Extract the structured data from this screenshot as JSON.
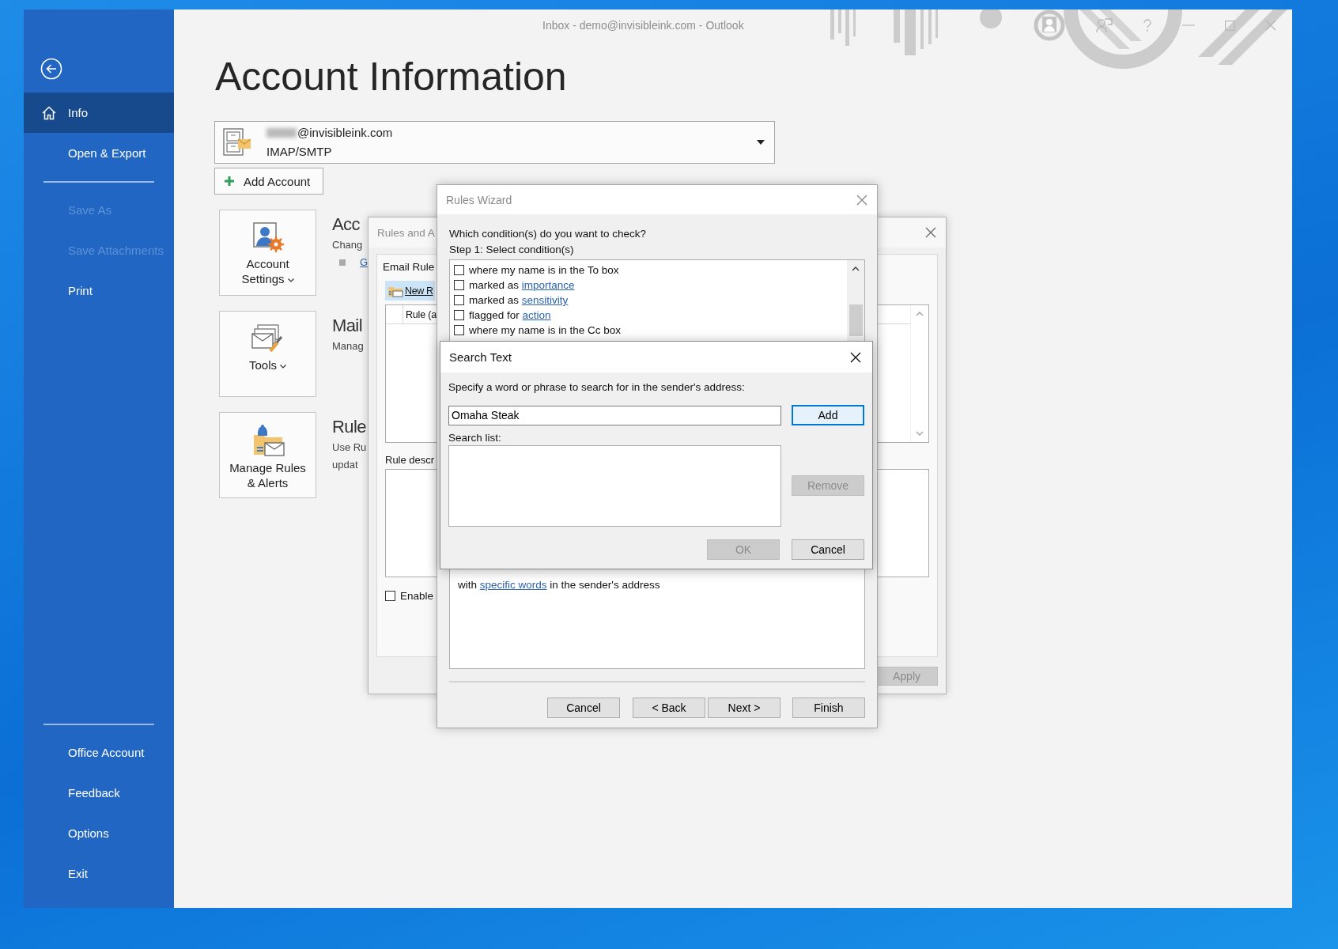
{
  "window": {
    "title": "Inbox - demo@invisibleink.com - Outlook"
  },
  "sidebar": {
    "top_groups": [
      [
        {
          "label": "Info",
          "selected": true,
          "disabled": false
        },
        {
          "label": "Open & Export",
          "selected": false,
          "disabled": false
        }
      ],
      [
        {
          "label": "Save As",
          "selected": false,
          "disabled": true
        },
        {
          "label": "Save Attachments",
          "selected": false,
          "disabled": true
        },
        {
          "label": "Print",
          "selected": false,
          "disabled": false
        }
      ]
    ],
    "bottom_items": [
      {
        "label": "Office Account",
        "selected": false,
        "disabled": false
      },
      {
        "label": "Feedback",
        "selected": false,
        "disabled": false
      },
      {
        "label": "Options",
        "selected": false,
        "disabled": false
      },
      {
        "label": "Exit",
        "selected": false,
        "disabled": false
      }
    ]
  },
  "account_info": {
    "heading": "Account Information",
    "account": {
      "email": "@invisibleink.com",
      "type": "IMAP/SMTP"
    },
    "add_account": "Add Account",
    "sections": [
      {
        "tile": "Account Settings",
        "menu": true,
        "heading": "Acc",
        "lines": [
          "Chang"
        ],
        "link": "G"
      },
      {
        "tile": "Tools",
        "menu": true,
        "heading": "Mail",
        "lines": [
          "Manag"
        ]
      },
      {
        "tile": "Manage Rules & Alerts",
        "menu": false,
        "heading": "Rule",
        "lines": [
          "Use Ru",
          "updat"
        ]
      }
    ]
  },
  "rules_and_alerts": {
    "title": "Rules and A",
    "tab": "Email Rule",
    "new_rule": "New R",
    "column": "Rule (a",
    "description_label": "Rule descr",
    "enable": {
      "label": "Enable",
      "checked": false
    },
    "apply": {
      "label": "Apply",
      "disabled": true
    }
  },
  "rules_wizard": {
    "title": "Rules Wizard",
    "question": "Which condition(s) do you want to check?",
    "step": "Step 1: Select condition(s)",
    "conditions": [
      {
        "text": "where my name is in the To box",
        "checked": false
      },
      {
        "text": "marked as",
        "link": "importance",
        "checked": false
      },
      {
        "text": "marked as",
        "link": "sensitivity",
        "checked": false
      },
      {
        "text": "flagged for",
        "link": "action",
        "checked": false
      },
      {
        "text": "where my name is in the Cc box",
        "checked": false
      }
    ],
    "description": {
      "text": "with",
      "link": "specific words",
      "after": "in the sender's address"
    },
    "buttons": [
      {
        "label": "Cancel",
        "disabled": false
      },
      {
        "label": "< Back",
        "disabled": false
      },
      {
        "label": "Next >",
        "disabled": false
      },
      {
        "label": "Finish",
        "disabled": false
      }
    ]
  },
  "search_text": {
    "title": "Search Text",
    "prompt": "Specify a word or phrase to search for in the sender's address:",
    "value": "Omaha Steak",
    "list_label": "Search list:",
    "add": {
      "label": "Add",
      "default": true
    },
    "remove": {
      "label": "Remove",
      "disabled": true
    },
    "ok": {
      "label": "OK",
      "disabled": true
    },
    "cancel": {
      "label": "Cancel",
      "disabled": false
    }
  }
}
